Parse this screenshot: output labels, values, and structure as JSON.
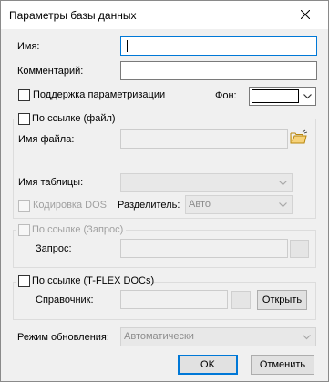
{
  "window": {
    "title": "Параметры базы данных"
  },
  "fields": {
    "name_label": "Имя:",
    "name_value": "",
    "comment_label": "Комментарий:",
    "comment_value": "",
    "parametrization_label": "Поддержка параметризации",
    "background_label": "Фон:",
    "background_color": "#ffffff"
  },
  "file_link": {
    "checkbox_label": "По ссылке (файл)",
    "filename_label": "Имя файла:",
    "filename_value": "",
    "table_label": "Имя таблицы:",
    "table_value": "",
    "dos_label": "Кодировка DOS",
    "separator_label": "Разделитель:",
    "separator_value": "Авто"
  },
  "query_link": {
    "checkbox_label": "По ссылке (Запрос)",
    "query_label": "Запрос:",
    "query_value": ""
  },
  "tflex_link": {
    "checkbox_label": "По ссылке (T-FLEX DOCs)",
    "reference_label": "Справочник:",
    "reference_value": "",
    "open_button": "Открыть"
  },
  "update": {
    "mode_label": "Режим обновления:",
    "mode_value": "Автоматически"
  },
  "buttons": {
    "ok": "OK",
    "cancel": "Отменить"
  },
  "colors": {
    "accent": "#0078d7",
    "dialog_bg": "#f0f0f0",
    "disabled_text": "#a0a0a0"
  }
}
